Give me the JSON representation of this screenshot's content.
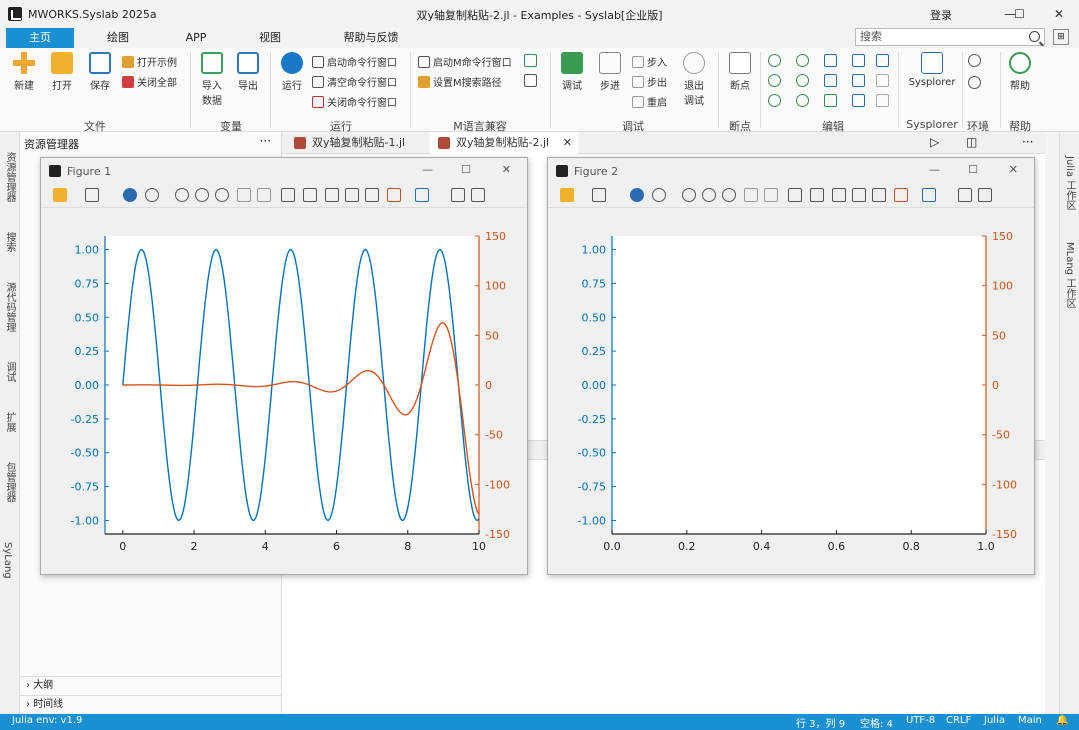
{
  "app": {
    "name": "MWORKS.Syslab 2025a",
    "doc_title": "双y轴复制粘贴-2.jl - Examples - Syslab[企业版]",
    "login": "登录"
  },
  "window_controls": {
    "minimize": "—",
    "maximize": "☐",
    "close": "✕"
  },
  "ribbon_tabs": [
    "主页",
    "绘图",
    "APP",
    "视图",
    "帮助与反馈"
  ],
  "search": {
    "placeholder": "搜索",
    "pin": "⊞"
  },
  "ribbon": {
    "file": {
      "label": "文件",
      "new": "新建",
      "open": "打开",
      "save": "保存",
      "open_example": "打开示例",
      "close_all": "关闭全部"
    },
    "variable": {
      "label": "变量",
      "import": "导入数据",
      "export": "导出"
    },
    "run": {
      "label": "运行",
      "run": "运行",
      "start_cmd": "启动命令行窗口",
      "clear_cmd": "清空命令行窗口",
      "close_cmd": "关闭命令行窗口"
    },
    "mlang": {
      "label": "M语言兼容",
      "start_m": "启动M命令行窗口",
      "set_m": "设置M搜索路径"
    },
    "debug": {
      "label": "调试",
      "debug": "调试",
      "step": "步进",
      "step_in": "步入",
      "step_out": "步出",
      "restart": "重启",
      "exit": "退出调试"
    },
    "breakpoint": {
      "label": "断点",
      "bp": "断点"
    },
    "edit": {
      "label": "编辑"
    },
    "sysplorer": {
      "label": "Sysplorer",
      "btn": "Sysplorer"
    },
    "env": {
      "label": "环境"
    },
    "help": {
      "label": "帮助",
      "btn": "帮助"
    }
  },
  "left_panels": [
    "资源管理器",
    "搜索",
    "源代码管理",
    "调试",
    "扩展",
    "包管理器",
    "SyLang"
  ],
  "resource_manager": {
    "title": "资源管理器",
    "more": "···",
    "outline": "大纲",
    "timeline": "时间线"
  },
  "editor_tabs": [
    {
      "label": "双y轴复制粘贴-1.jl",
      "active": false
    },
    {
      "label": "双y轴复制粘贴-2.jl",
      "active": true,
      "close": "✕"
    }
  ],
  "editor_actions": {
    "run": "▷",
    "split": "◫",
    "more": "···"
  },
  "right_panels": [
    "Julia 工作区",
    "MLang 工作区"
  ],
  "figures": [
    {
      "title": "Figure 1"
    },
    {
      "title": "Figure 2"
    }
  ],
  "chart_data": [
    {
      "type": "line",
      "title": "",
      "xlabel": "",
      "ylabel": "",
      "xlim": [
        -0.5,
        10
      ],
      "ylim": [
        -1.1,
        1.1
      ],
      "y2lim": [
        -150,
        150
      ],
      "xticks": [
        0,
        2,
        4,
        6,
        8,
        10
      ],
      "yticks": [
        -1.0,
        -0.75,
        -0.5,
        -0.25,
        0.0,
        0.25,
        0.5,
        0.75,
        1.0
      ],
      "y2ticks": [
        -150,
        -100,
        -50,
        0,
        50,
        100,
        150
      ],
      "series": [
        {
          "axis": "left",
          "color": "#0072bd",
          "formula": "sin(3x)",
          "x_range": [
            0,
            10
          ]
        },
        {
          "axis": "right",
          "color": "#d95319",
          "formula": "(0.1*exp(0.7x))*sin(3x) approx",
          "x_range": [
            0,
            10
          ]
        }
      ],
      "colors": {
        "left_axis": "#0072bd",
        "right_axis": "#d95319"
      }
    },
    {
      "type": "line",
      "title": "",
      "xlim": [
        0,
        1
      ],
      "ylim": [
        -1.1,
        1.1
      ],
      "y2lim": [
        -150,
        150
      ],
      "xticks": [
        0.0,
        0.2,
        0.4,
        0.6,
        0.8,
        1.0
      ],
      "yticks": [
        -1.0,
        -0.75,
        -0.5,
        -0.25,
        0.0,
        0.25,
        0.5,
        0.75,
        1.0
      ],
      "y2ticks": [
        -150,
        -100,
        -50,
        0,
        50,
        100,
        150
      ],
      "series": [],
      "colors": {
        "left_axis": "#0072bd",
        "right_axis": "#d95319"
      }
    }
  ],
  "status": {
    "env": "Julia env: v1.9",
    "position": "行 3，列 9",
    "spaces": "空格: 4",
    "encoding": "UTF-8",
    "eol": "CRLF",
    "lang": "Julia",
    "branch": "Main"
  }
}
